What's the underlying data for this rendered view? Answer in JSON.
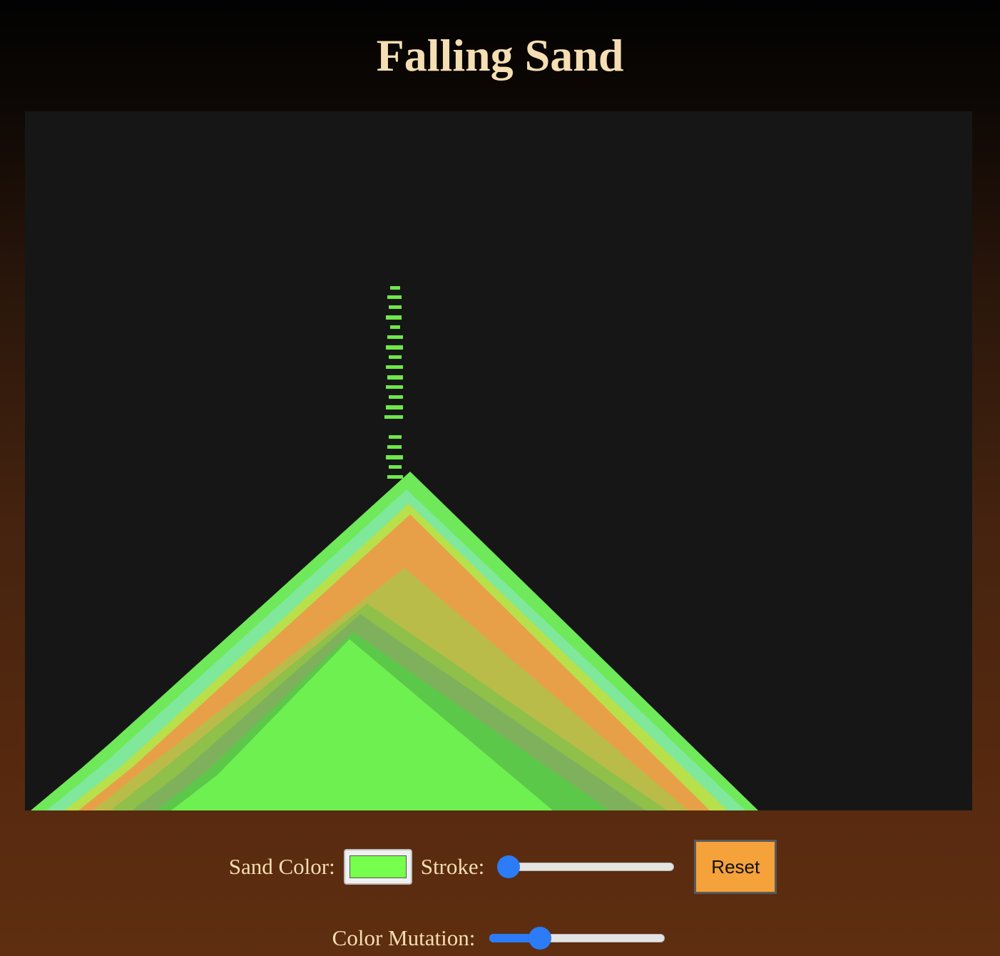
{
  "page": {
    "title": "Falling Sand"
  },
  "controls": {
    "sand_color_label": "Sand Color:",
    "sand_color_value": "#77ff4d",
    "stroke_label": "Stroke:",
    "stroke_value": 0,
    "reset_label": "Reset",
    "color_mutation_label": "Color Mutation:",
    "color_mutation_value": 0.26
  },
  "colors": {
    "canvas_background": "#161616",
    "slider_accent": "#2b7cf6",
    "reset_button": "#f5a23a",
    "title_text": "#f5deb3"
  }
}
